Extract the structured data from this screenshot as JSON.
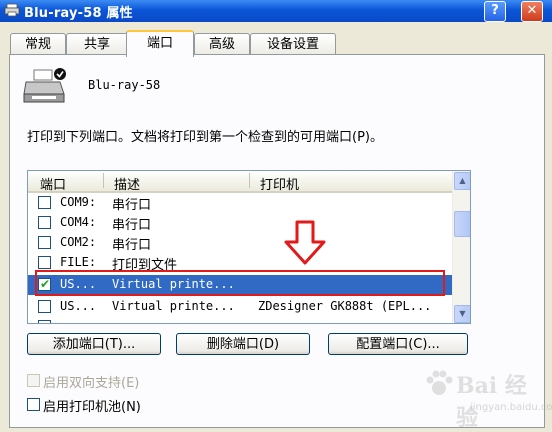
{
  "window": {
    "title": "Blu-ray-58 属性",
    "help_label": "?",
    "close_label": "✕"
  },
  "tabs": [
    {
      "label": "常规"
    },
    {
      "label": "共享"
    },
    {
      "label": "端口",
      "active": true
    },
    {
      "label": "高级"
    },
    {
      "label": "设备设置"
    }
  ],
  "printer": {
    "name": "Blu-ray-58",
    "icon": "printer-icon"
  },
  "instruction": "打印到下列端口。文档将打印到第一个检查到的可用端口(P)。",
  "port_list": {
    "columns": [
      "端口",
      "描述",
      "打印机"
    ],
    "rows": [
      {
        "port": "COM9:",
        "description": "串行口",
        "printer": "",
        "checked": false,
        "selected": false
      },
      {
        "port": "COM4:",
        "description": "串行口",
        "printer": "",
        "checked": false,
        "selected": false
      },
      {
        "port": "COM2:",
        "description": "串行口",
        "printer": "",
        "checked": false,
        "selected": false
      },
      {
        "port": "FILE:",
        "description": "打印到文件",
        "printer": "",
        "checked": false,
        "selected": false
      },
      {
        "port": "US...",
        "description": "Virtual printe...",
        "printer": "",
        "checked": true,
        "selected": true
      },
      {
        "port": "US...",
        "description": "Virtual printe...",
        "printer": "ZDesigner GK888t (EPL...",
        "checked": false,
        "selected": false
      }
    ]
  },
  "buttons": {
    "add_port": "添加端口(T)...",
    "delete_port": "删除端口(D)",
    "configure_port": "配置端口(C)..."
  },
  "options": {
    "bidirectional": "启用双向支持(E)",
    "printer_pool": "启用打印机池(N)"
  },
  "watermark": {
    "text": "Bai 经验",
    "sub": "jingyan.baidu.com"
  },
  "colors": {
    "title_bar": "#0b56d8",
    "selection": "#316ac5",
    "highlight_box": "#e21a1a",
    "tab_accent": "#ffc83c"
  }
}
